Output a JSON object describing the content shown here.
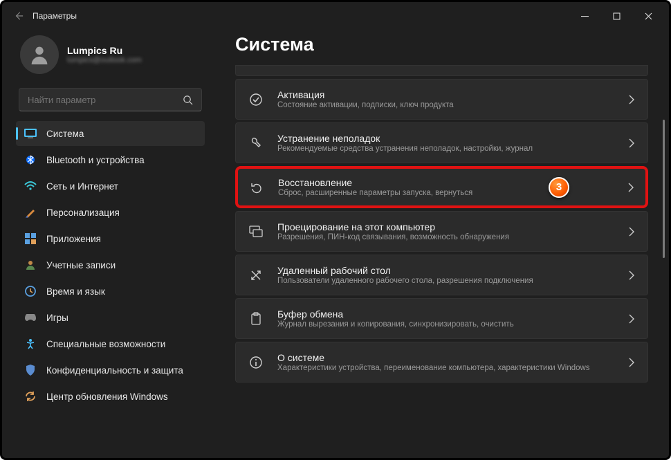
{
  "window": {
    "title": "Параметры"
  },
  "account": {
    "name": "Lumpics Ru",
    "email": "lumpics@outlook.com"
  },
  "search": {
    "placeholder": "Найти параметр"
  },
  "sidebar": {
    "items": [
      {
        "label": "Система",
        "icon": "system"
      },
      {
        "label": "Bluetooth и устройства",
        "icon": "bluetooth"
      },
      {
        "label": "Сеть и Интернет",
        "icon": "wifi"
      },
      {
        "label": "Персонализация",
        "icon": "personalization"
      },
      {
        "label": "Приложения",
        "icon": "apps"
      },
      {
        "label": "Учетные записи",
        "icon": "accounts"
      },
      {
        "label": "Время и язык",
        "icon": "time"
      },
      {
        "label": "Игры",
        "icon": "gaming"
      },
      {
        "label": "Специальные возможности",
        "icon": "accessibility"
      },
      {
        "label": "Конфиденциальность и защита",
        "icon": "privacy"
      },
      {
        "label": "Центр обновления Windows",
        "icon": "update"
      }
    ]
  },
  "page": {
    "title": "Система"
  },
  "settings": {
    "items": [
      {
        "title": "Активация",
        "sub": "Состояние активации, подписки, ключ продукта"
      },
      {
        "title": "Устранение неполадок",
        "sub": "Рекомендуемые средства устранения неполадок, настройки, журнал"
      },
      {
        "title": "Восстановление",
        "sub": "Сброс, расширенные параметры запуска, вернуться"
      },
      {
        "title": "Проецирование на этот компьютер",
        "sub": "Разрешения, ПИН-код связывания, возможность обнаружения"
      },
      {
        "title": "Удаленный рабочий стол",
        "sub": "Пользователи удаленного рабочего стола, разрешения подключения"
      },
      {
        "title": "Буфер обмена",
        "sub": "Журнал вырезания и копирования, синхронизировать, очистить"
      },
      {
        "title": "О системе",
        "sub": "Характеристики устройства, переименование компьютера, характеристики Windows"
      }
    ]
  },
  "highlight": {
    "badge": "3"
  }
}
